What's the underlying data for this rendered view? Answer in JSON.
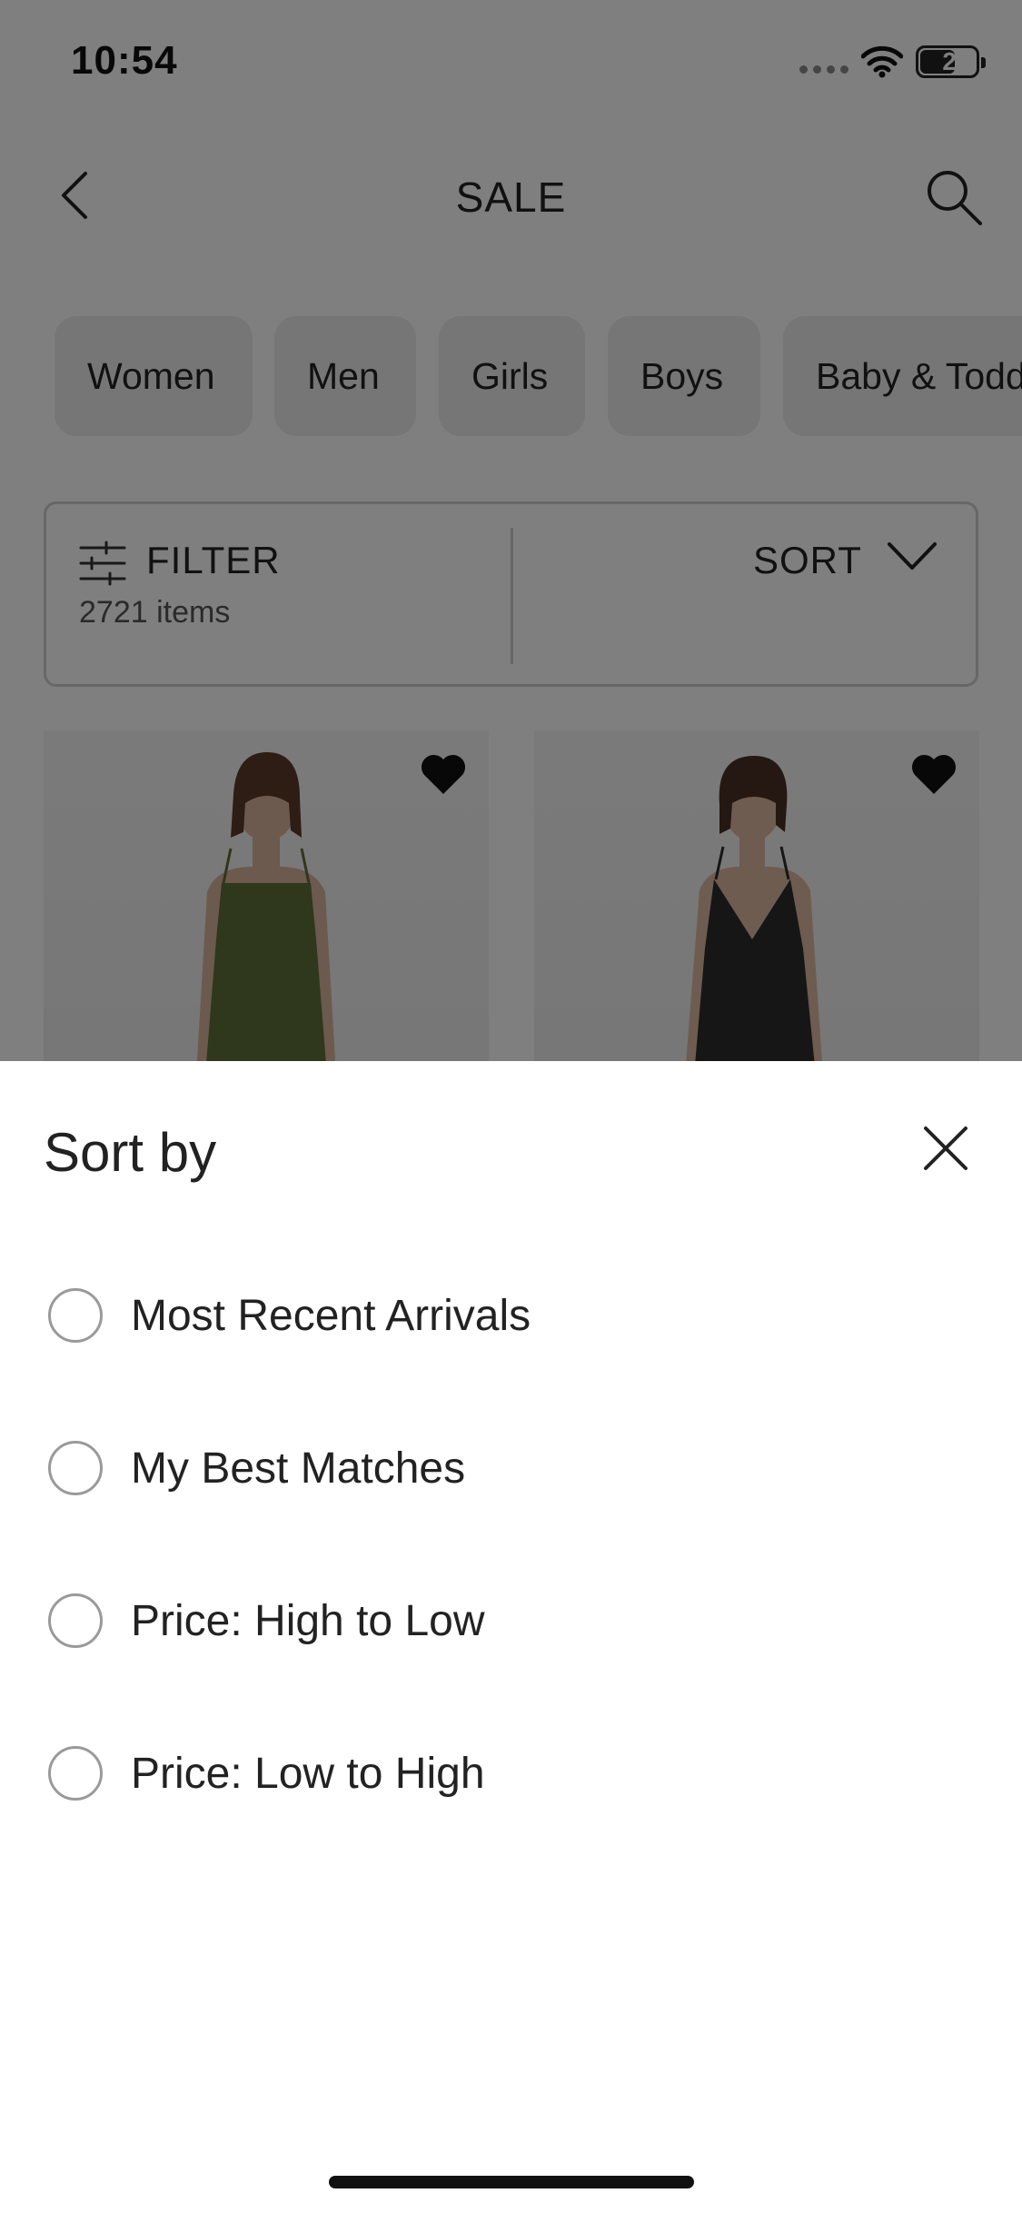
{
  "status_bar": {
    "time": "10:54",
    "battery": "24"
  },
  "header": {
    "title": "SALE"
  },
  "categories": [
    "Women",
    "Men",
    "Girls",
    "Boys",
    "Baby & Toddler"
  ],
  "filter_bar": {
    "filter_label": "FILTER",
    "item_count": "2721 items",
    "sort_label": "SORT"
  },
  "products": [
    {
      "favorited": true,
      "dress_color": "#5f6e3a"
    },
    {
      "favorited": true,
      "dress_color": "#2c2c2c"
    }
  ],
  "sort_sheet": {
    "title": "Sort by",
    "options": [
      {
        "label": "Most Recent Arrivals",
        "selected": false
      },
      {
        "label": "My Best Matches",
        "selected": false
      },
      {
        "label": "Price: High to Low",
        "selected": false
      },
      {
        "label": "Price: Low to High",
        "selected": false
      }
    ]
  },
  "icons": [
    "signal-icon",
    "wifi-icon",
    "battery-icon",
    "back-icon",
    "search-icon",
    "filter-icon",
    "chevron-down-icon",
    "heart-icon",
    "close-icon"
  ]
}
